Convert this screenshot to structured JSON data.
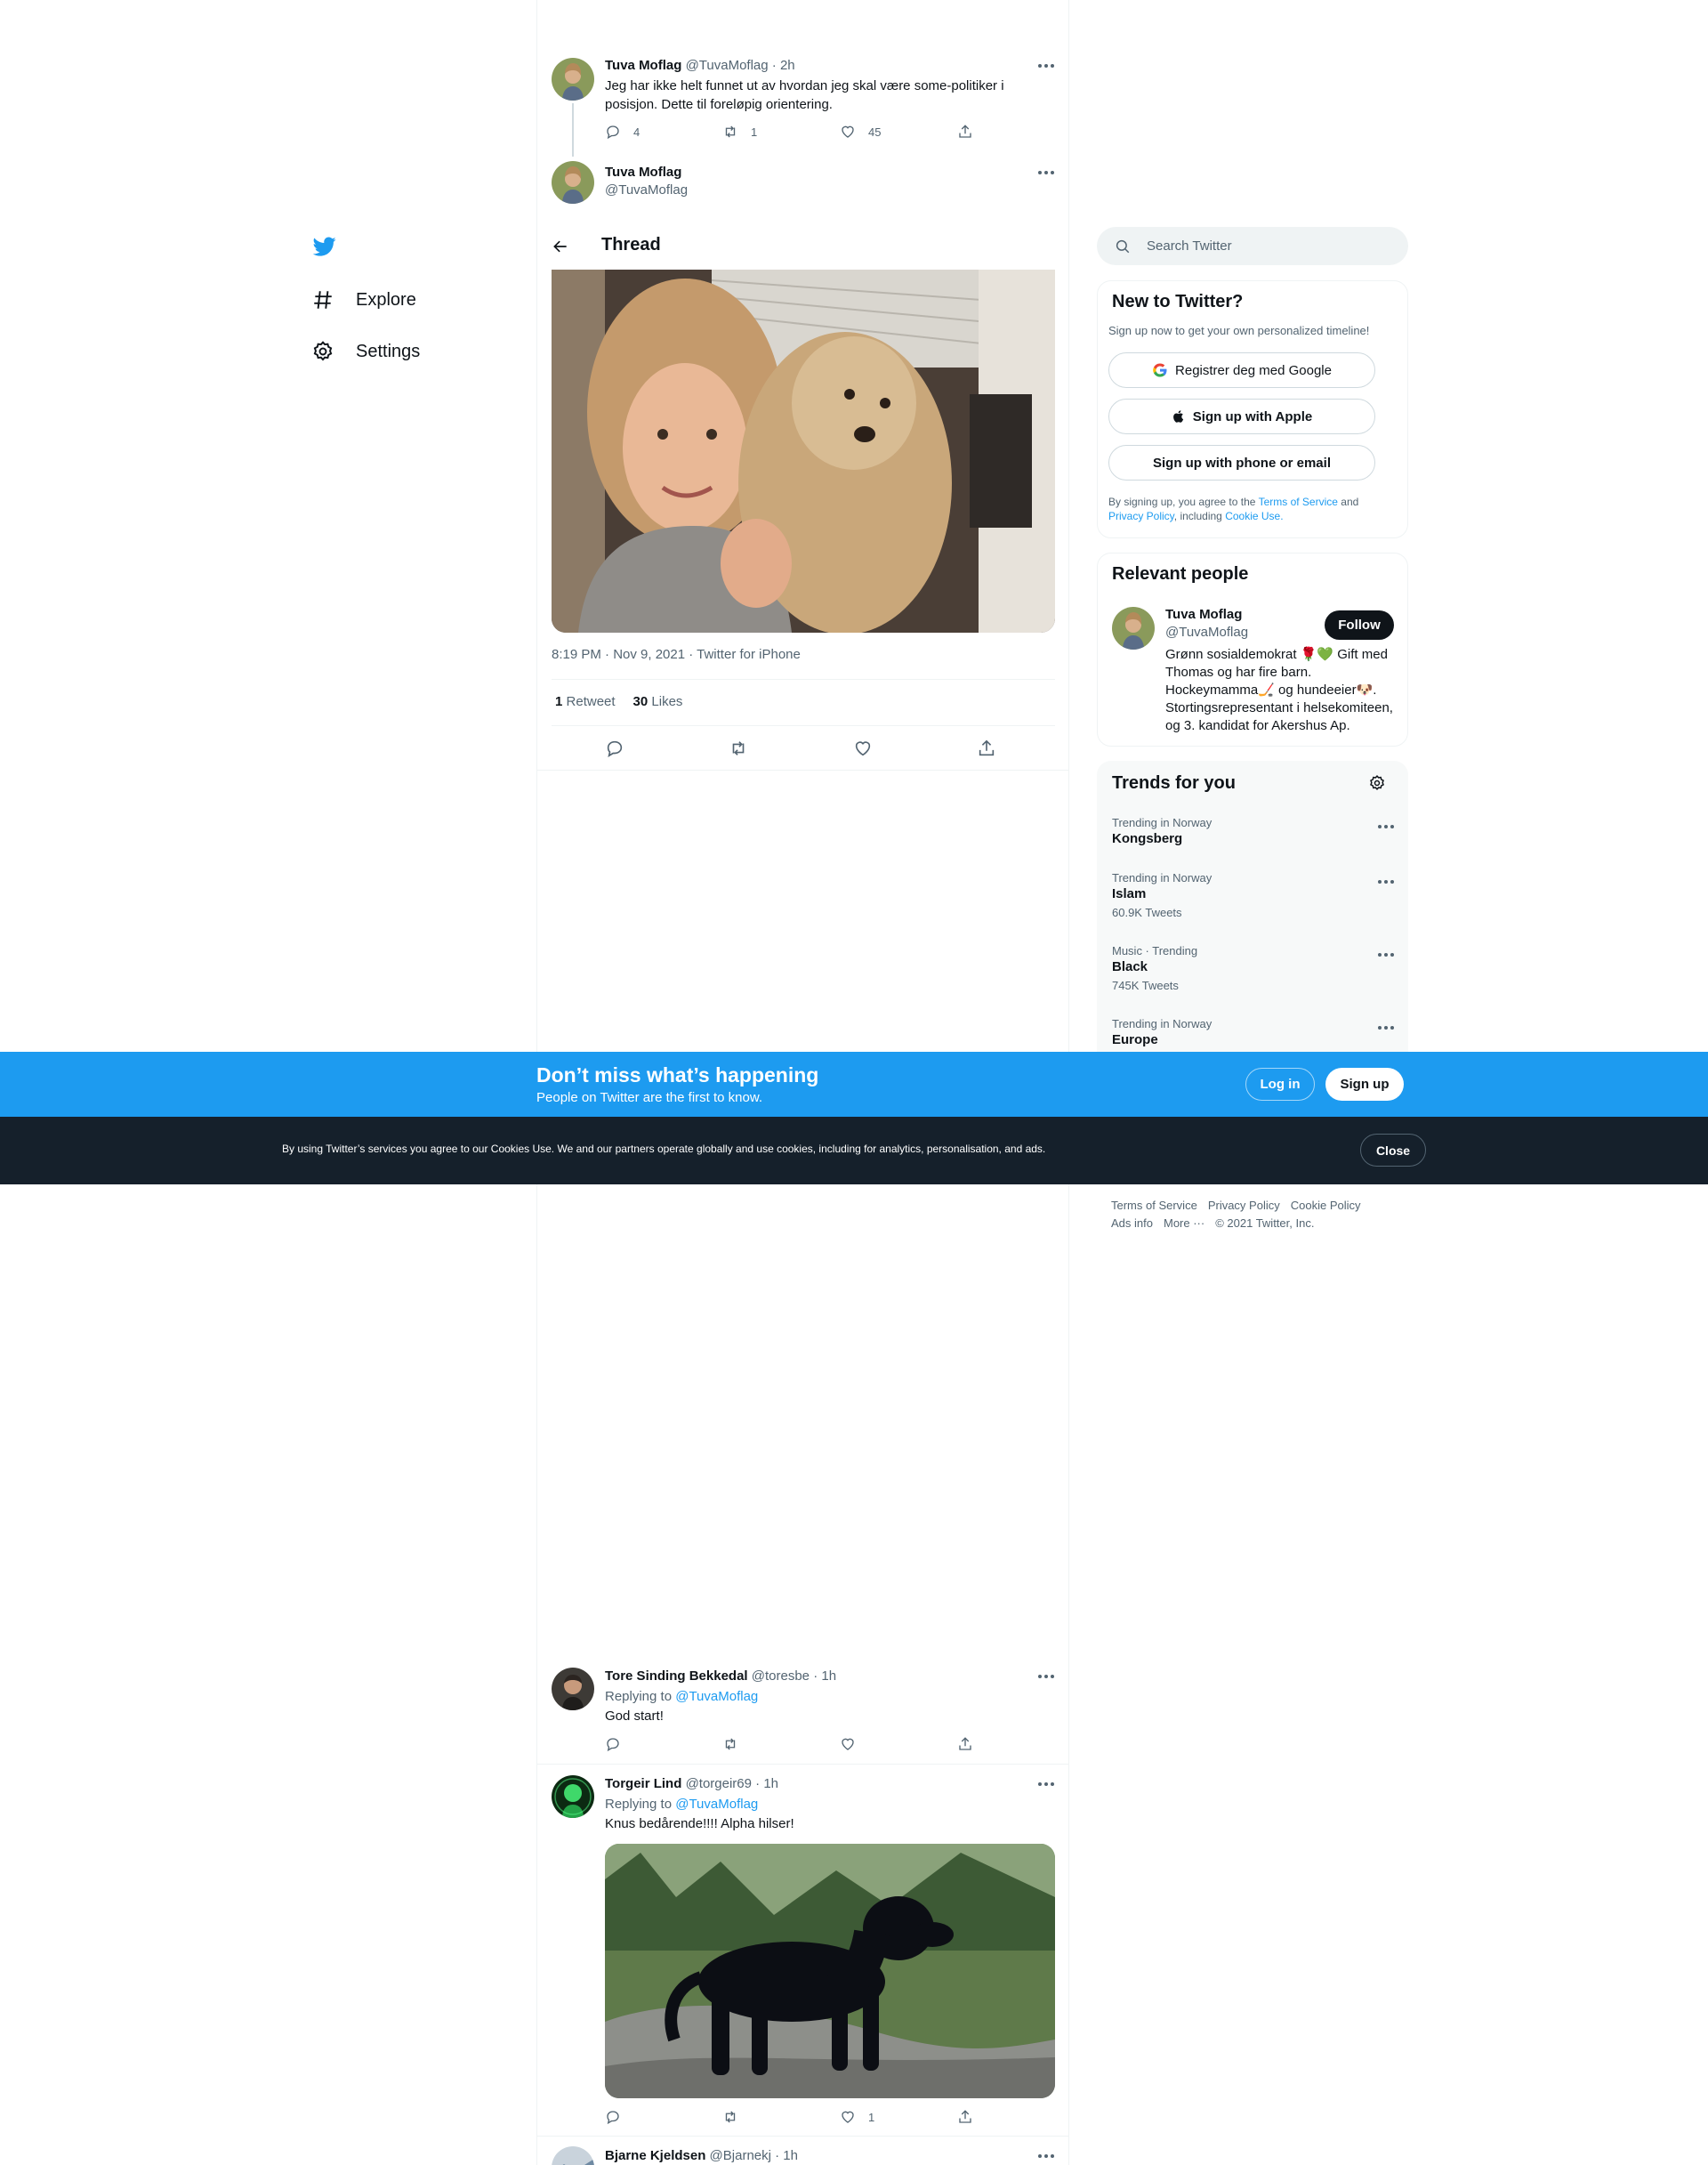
{
  "nav": {
    "explore": "Explore",
    "settings": "Settings"
  },
  "header": {
    "title": "Thread"
  },
  "parent_tweet": {
    "name": "Tuva Moflag",
    "handle": "@TuvaMoflag",
    "time": "· 2h",
    "text_line1": "Jeg har ikke helt funnet ut av hvordan jeg skal være some-politiker i",
    "text_line2": "posisjon. Dette til foreløpig orientering.",
    "replies": "4",
    "retweets": "1",
    "likes": "45"
  },
  "main_tweet": {
    "name": "Tuva Moflag",
    "handle": "@TuvaMoflag",
    "timestamp": "8:19 PM · Nov 9, 2021 · Twitter for iPhone",
    "retweet_count": "1",
    "retweet_label": "Retweet",
    "like_count": "30",
    "like_label": "Likes"
  },
  "replies": [
    {
      "name": "Tore Sinding Bekkedal",
      "handle": "@toresbe",
      "time": "· 1h",
      "replying": "Replying to",
      "replying_to": "@TuvaMoflag",
      "text": "God start!"
    },
    {
      "name": "Torgeir Lind",
      "handle": "@torgeir69",
      "time": "· 1h",
      "replying": "Replying to",
      "replying_to": "@TuvaMoflag",
      "text": "Knus bedårende!!!! Alpha hilser!",
      "likes": "1"
    },
    {
      "name": "Bjarne Kjeldsen",
      "handle": "@Bjarnekj",
      "time": "· 1h"
    }
  ],
  "search": {
    "placeholder": "Search Twitter"
  },
  "signup": {
    "title": "New to Twitter?",
    "subtitle": "Sign up now to get your own personalized timeline!",
    "google": "Registrer deg med Google",
    "apple": "Sign up with Apple",
    "phone": "Sign up with phone or email",
    "terms_pre": "By signing up, you agree to the",
    "terms_link": "Terms of Service",
    "terms_and": "and",
    "privacy_link": "Privacy Policy",
    "including": ", including",
    "cookie_link": "Cookie Use."
  },
  "relevant": {
    "title": "Relevant people",
    "name": "Tuva Moflag",
    "handle": "@TuvaMoflag",
    "follow": "Follow",
    "bio_line1": "Grønn sosialdemokrat 🌹💚 Gift med",
    "bio_line2": "Thomas og har fire barn.",
    "bio_line3": "Hockeymamma🏒 og hundeeier🐶.",
    "bio_line4": "Stortingsrepresentant i helsekomiteen,",
    "bio_line5": "og 3. kandidat for Akershus Ap."
  },
  "trends": {
    "title": "Trends for you",
    "items": [
      {
        "meta": "Trending in Norway",
        "title": "Kongsberg",
        "count": ""
      },
      {
        "meta": "Trending in Norway",
        "title": "Islam",
        "count": "60.9K Tweets"
      },
      {
        "meta": "Music · Trending",
        "title": "Black",
        "count": "745K Tweets"
      },
      {
        "meta": "Trending in Norway",
        "title": "Europe",
        "count": ""
      }
    ]
  },
  "footer": {
    "terms": "Terms of Service",
    "privacy": "Privacy Policy",
    "cookie": "Cookie Policy",
    "ads": "Ads info",
    "more": "More ···",
    "copyright": "© 2021 Twitter, Inc."
  },
  "banner": {
    "title": "Don’t miss what’s happening",
    "subtitle": "People on Twitter are the first to know.",
    "login": "Log in",
    "signup": "Sign up"
  },
  "cookie_bar": {
    "text": "By using Twitter’s services you agree to our Cookies Use. We and our partners operate globally and use cookies, including for analytics, personalisation, and ads.",
    "close": "Close"
  },
  "colors": {
    "accent": "#1d9bf0",
    "dark_bar": "#15202b",
    "text_primary": "#0f1419",
    "text_secondary": "#536471"
  }
}
